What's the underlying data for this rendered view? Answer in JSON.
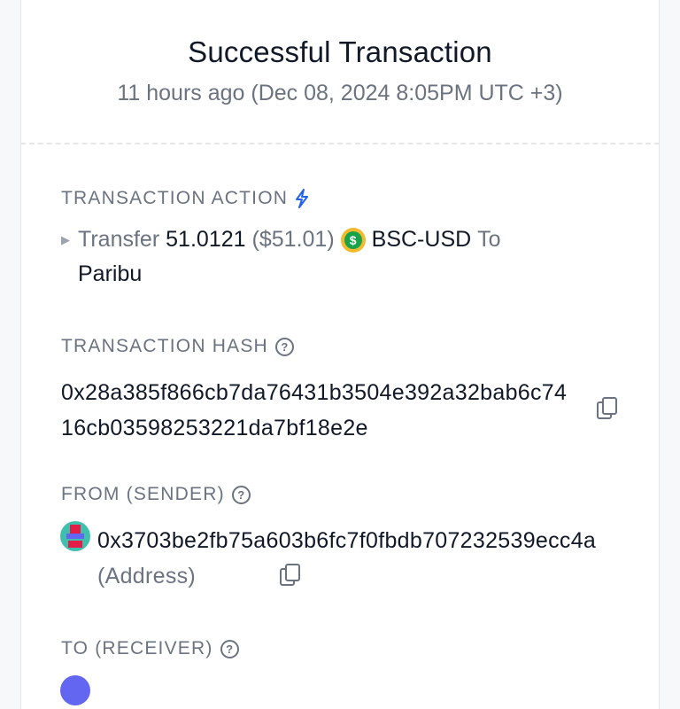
{
  "header": {
    "title": "Successful Transaction",
    "subtitle": "11 hours ago (Dec 08, 2024 8:05PM UTC +3)"
  },
  "action": {
    "label": "TRANSACTION ACTION",
    "verb": "Transfer",
    "amount": "51.0121",
    "usd": "($51.01)",
    "token": "BSC-USD",
    "to_word": "To",
    "recipient": "Paribu"
  },
  "hash": {
    "label": "TRANSACTION HASH",
    "value": "0x28a385f866cb7da76431b3504e392a32bab6c7416cb03598253221da7bf18e2e"
  },
  "from": {
    "label": "FROM (SENDER)",
    "address": "0x3703be2fb75a603b6fc7f0fbdb707232539ecc4a",
    "tag": "(Address)"
  },
  "to": {
    "label": "TO (RECEIVER)"
  },
  "colors": {
    "success": "#10a37f",
    "accent": "#2563eb",
    "muted": "#6b7280"
  }
}
